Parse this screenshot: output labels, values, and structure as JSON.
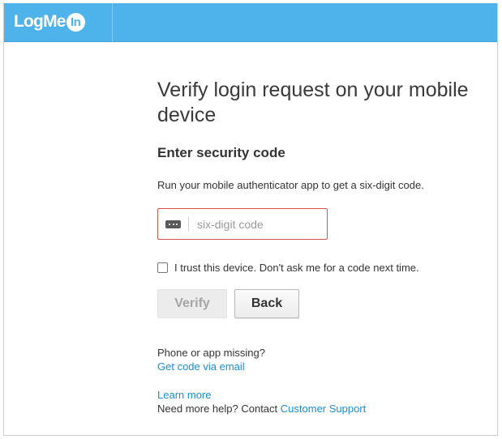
{
  "brand": {
    "logo_text": "LogMe",
    "logo_badge": "In",
    "topbar_color": "#4db3ea"
  },
  "main": {
    "title": "Verify login request on your mobile device",
    "subtitle": "Enter security code",
    "instructions": "Run your mobile authenticator app to get a six-digit code.",
    "code_field": {
      "placeholder": "six-digit code",
      "value": "",
      "icon": "password-dots-icon",
      "border_color": "#d9534f"
    },
    "trust_device": {
      "label": "I trust this device. Don't ask me for a code next time.",
      "checked": false
    },
    "buttons": {
      "verify_label": "Verify",
      "back_label": "Back"
    },
    "missing": {
      "prompt": "Phone or app missing?",
      "link": "Get code via email"
    },
    "help": {
      "learn_more": "Learn more",
      "prompt": "Need more help? Contact",
      "support_link": "Customer Support"
    },
    "link_color": "#1a8ed6"
  }
}
